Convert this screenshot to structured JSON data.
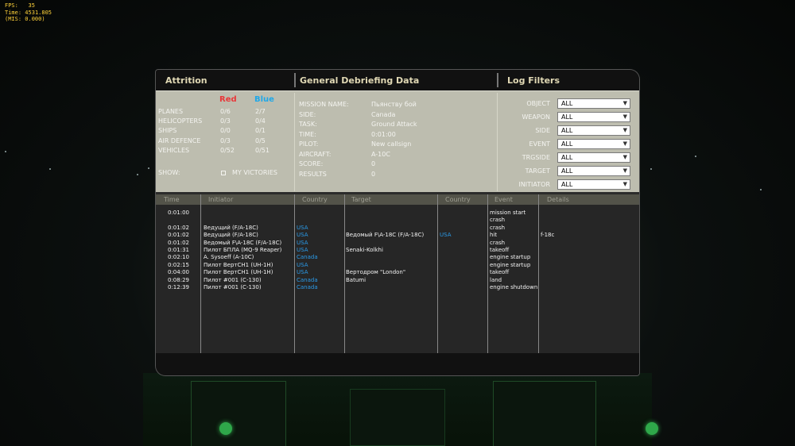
{
  "hud": {
    "fps_label": "FPS:",
    "fps": "35",
    "time_label": "Time:",
    "time": "4531.805",
    "mis": "(MIS: 0.000)"
  },
  "sections": {
    "attrition": "Attrition",
    "debrief": "General Debriefing Data",
    "filters": "Log Filters"
  },
  "attrition": {
    "red_label": "Red",
    "blue_label": "Blue",
    "colors": {
      "red": "#e8383a",
      "blue": "#20a8e8"
    },
    "rows": [
      {
        "label": "PLANES",
        "red": "0/6",
        "blue": "2/7"
      },
      {
        "label": "HELICOPTERS",
        "red": "0/3",
        "blue": "0/4"
      },
      {
        "label": "SHIPS",
        "red": "0/0",
        "blue": "0/1"
      },
      {
        "label": "AIR DEFENCE",
        "red": "0/3",
        "blue": "0/5"
      },
      {
        "label": "VEHICLES",
        "red": "0/52",
        "blue": "0/51"
      }
    ],
    "show_label": "SHOW:",
    "my_victories_label": "MY VICTORIES"
  },
  "debrief": [
    {
      "label": "MISSION NAME:",
      "value": "Пьянству бой"
    },
    {
      "label": "SIDE:",
      "value": "Canada"
    },
    {
      "label": "TASK:",
      "value": "Ground Attack"
    },
    {
      "label": "TIME:",
      "value": "0:01:00"
    },
    {
      "label": "PILOT:",
      "value": "New callsign"
    },
    {
      "label": "AIRCRAFT:",
      "value": "A-10C"
    },
    {
      "label": "SCORE:",
      "value": "0"
    },
    {
      "label": "RESULTS",
      "value": "0"
    }
  ],
  "filters": [
    {
      "label": "OBJECT",
      "value": "ALL"
    },
    {
      "label": "WEAPON",
      "value": "ALL"
    },
    {
      "label": "SIDE",
      "value": "ALL"
    },
    {
      "label": "EVENT",
      "value": "ALL"
    },
    {
      "label": "TRGSIDE",
      "value": "ALL"
    },
    {
      "label": "TARGET",
      "value": "ALL"
    },
    {
      "label": "INITIATOR",
      "value": "ALL"
    }
  ],
  "log": {
    "headers": {
      "time": "Time",
      "initiator": "Initiator",
      "country": "Country",
      "target": "Target",
      "tcountry": "Country",
      "event": "Event",
      "details": "Details"
    },
    "rows": [
      {
        "time": "0:01:00",
        "initiator": "",
        "country": "",
        "target": "",
        "tcountry": "",
        "event": "mission start",
        "details": ""
      },
      {
        "time": "",
        "initiator": "",
        "country": "",
        "target": "",
        "tcountry": "",
        "event": "crash",
        "details": ""
      },
      {
        "time": "0:01:02",
        "initiator": "Ведущий (F/A-18C)",
        "country": "USA",
        "target": "",
        "tcountry": "",
        "event": "crash",
        "details": ""
      },
      {
        "time": "0:01:02",
        "initiator": "Ведущий (F/A-18C)",
        "country": "USA",
        "target": "Ведомый F\\A-18C (F/A-18C)",
        "tcountry": "USA",
        "event": "hit",
        "details": "f-18c"
      },
      {
        "time": "0:01:02",
        "initiator": "Ведомый F\\A-18C (F/A-18C)",
        "country": "USA",
        "target": "",
        "tcountry": "",
        "event": "crash",
        "details": ""
      },
      {
        "time": "0:01:31",
        "initiator": "Пилот БПЛА (MQ-9 Reaper)",
        "country": "USA",
        "target": "Senaki-Kolkhi",
        "tcountry": "",
        "event": "takeoff",
        "details": ""
      },
      {
        "time": "0:02:10",
        "initiator": "A. Sysoeff (A-10C)",
        "country": "Canada",
        "target": "",
        "tcountry": "",
        "event": "engine startup",
        "details": ""
      },
      {
        "time": "0:02:15",
        "initiator": "Пилот ВертСН1 (UH-1H)",
        "country": "USA",
        "target": "",
        "tcountry": "",
        "event": "engine startup",
        "details": ""
      },
      {
        "time": "0:04:00",
        "initiator": "Пилот ВертСН1 (UH-1H)",
        "country": "USA",
        "target": "Вертодром \"London\"",
        "tcountry": "",
        "event": "takeoff",
        "details": ""
      },
      {
        "time": "0:08:29",
        "initiator": "Пилот #001 (C-130)",
        "country": "Canada",
        "target": "Batumi",
        "tcountry": "",
        "event": "land",
        "details": ""
      },
      {
        "time": "0:12:39",
        "initiator": "Пилот #001 (C-130)",
        "country": "Canada",
        "target": "",
        "tcountry": "",
        "event": "engine shutdown",
        "details": ""
      }
    ]
  }
}
